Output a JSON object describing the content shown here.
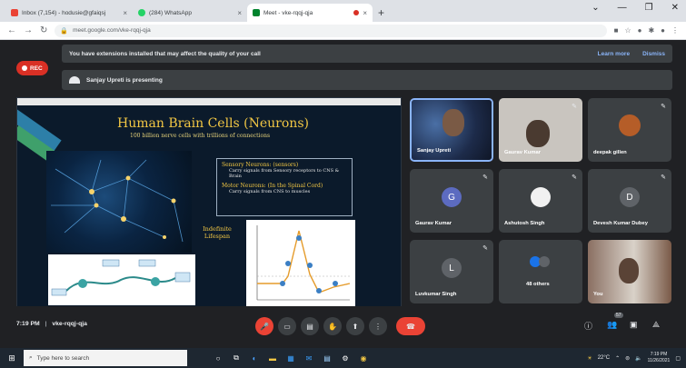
{
  "browser": {
    "tabs": [
      {
        "title": "Inbox (7,154) - hodusie@gfaiqsj",
        "close": "×"
      },
      {
        "title": "(284) WhatsApp",
        "close": "×"
      },
      {
        "title": "Meet - vke-rqqj-qja",
        "close": "×"
      }
    ],
    "new_tab": "+",
    "window_controls": [
      "⌄",
      "—",
      "❐",
      "✕"
    ],
    "url": "meet.google.com/vke-rqqj-qja"
  },
  "meet": {
    "banner_text": "You have extensions installed that may affect the quality of your call",
    "banner_learn_more": "Learn more",
    "banner_dismiss": "Dismiss",
    "rec_label": "REC",
    "presenting_text": "Sanjay Upreti is presenting",
    "slide": {
      "title": "Human Brain Cells (Neurons)",
      "subtitle": "100 billion nerve cells with trillions of connections",
      "sensory_heading": "Sensory Neurons: (sensors)",
      "sensory_bullet": "Carry signals from Sensory receptors to CNS & Brain",
      "motor_heading": "Motor Neurons: (In the Spinal Cord)",
      "motor_bullet": "Carry signals from CNS to muscles",
      "indefinite": "Indefinite Lifespan"
    },
    "participants": [
      {
        "name": "Sanjay Upreti",
        "initial": "",
        "color": "#3d5a80"
      },
      {
        "name": "Gaurav Kumar",
        "initial": "",
        "color": "#c9c5bf"
      },
      {
        "name": "deepak gillen",
        "initial": "",
        "color": "#b55d28"
      },
      {
        "name": "Gaurav Kumar",
        "initial": "G",
        "color": "#5c6bc0"
      },
      {
        "name": "Ashutosh Singh",
        "initial": "",
        "color": "#f1f1f1"
      },
      {
        "name": "Devesh Kumar Dubey",
        "initial": "D",
        "color": "#5f6368"
      },
      {
        "name": "Luvkumar Singh",
        "initial": "L",
        "color": "#5f6368"
      },
      {
        "name": "48 others",
        "initial": "",
        "color": "#3c4043"
      },
      {
        "name": "You",
        "initial": "",
        "color": "#8a6f62"
      }
    ],
    "time": "7:19 PM",
    "meeting_code": "vke-rqqj-qja",
    "people_count": "57"
  },
  "taskbar": {
    "search_placeholder": "Type here to search",
    "weather": "22°C",
    "clock_time": "7:19 PM",
    "clock_date": "11/26/2021"
  },
  "colors": {
    "meet_bg": "#202124",
    "tile_bg": "#3c4043",
    "rec_red": "#d93025",
    "end_call_red": "#ea4335",
    "slide_title": "#f2c744"
  }
}
